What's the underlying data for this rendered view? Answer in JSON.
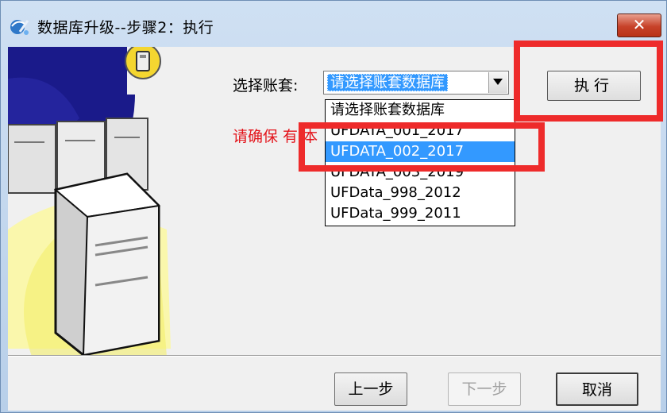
{
  "window": {
    "title": "数据库升级--步骤2：执行",
    "close_label": "✕"
  },
  "form": {
    "account_label": "选择账套:",
    "combo_value": "请选择账套数据库",
    "warning": "请确保 有 本",
    "exec_label": "执行"
  },
  "dropdown": {
    "items": [
      "请选择账套数据库",
      "UFDATA_001_2017",
      "UFDATA_002_2017",
      "UFDATA_003_2019",
      "UFData_998_2012",
      "UFData_999_2011"
    ],
    "selected_index": 2
  },
  "footer": {
    "prev_label": "上一步",
    "next_label": "下一步",
    "cancel_label": "取消"
  },
  "colors": {
    "highlight": "#ee2b2b",
    "selection": "#3399ff",
    "warning": "#e3141b"
  }
}
